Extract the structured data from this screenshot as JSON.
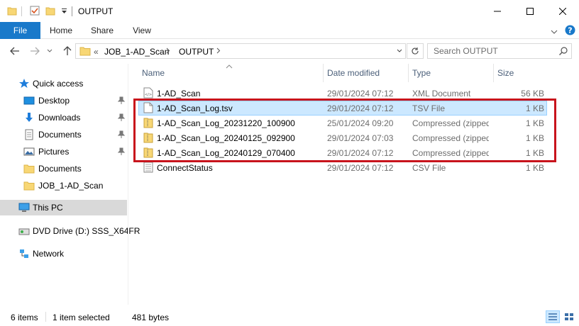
{
  "window": {
    "title": "OUTPUT",
    "minimize_glyph": "—",
    "maximize_glyph": "☐",
    "close_glyph": "✕"
  },
  "ribbon": {
    "tabs": [
      "File",
      "Home",
      "Share",
      "View"
    ]
  },
  "address": {
    "overflow": "«",
    "crumbs": [
      "JOB_1-AD_Scan",
      "OUTPUT"
    ]
  },
  "search": {
    "placeholder": "Search OUTPUT"
  },
  "sidebar": {
    "items": [
      {
        "label": "Quick access",
        "icon": "star-icon",
        "pinned": false
      },
      {
        "label": "Desktop",
        "icon": "desktop-icon",
        "pinned": true
      },
      {
        "label": "Downloads",
        "icon": "download-icon",
        "pinned": true
      },
      {
        "label": "Documents",
        "icon": "documents-icon",
        "pinned": true
      },
      {
        "label": "Pictures",
        "icon": "pictures-icon",
        "pinned": true
      },
      {
        "label": "Documents",
        "icon": "folder-icon",
        "pinned": false
      },
      {
        "label": "JOB_1-AD_Scan",
        "icon": "folder-icon",
        "pinned": false
      },
      {
        "label": "This PC",
        "icon": "computer-icon",
        "selected": true
      },
      {
        "label": "DVD Drive (D:) SSS_X64FR",
        "icon": "dvd-icon"
      },
      {
        "label": "Network",
        "icon": "network-icon"
      }
    ]
  },
  "columns": {
    "name": "Name",
    "date": "Date modified",
    "type": "Type",
    "size": "Size"
  },
  "files": [
    {
      "name": "1-AD_Scan",
      "date": "29/01/2024 07:12",
      "type": "XML Document",
      "size": "56 KB",
      "icon": "xml-file-icon"
    },
    {
      "name": "1-AD_Scan_Log.tsv",
      "date": "29/01/2024 07:12",
      "type": "TSV File",
      "size": "1 KB",
      "icon": "text-file-icon",
      "selected": true
    },
    {
      "name": "1-AD_Scan_Log_20231220_100900",
      "date": "25/01/2024 09:20",
      "type": "Compressed (zipped) Folder",
      "size": "1 KB",
      "icon": "zip-folder-icon"
    },
    {
      "name": "1-AD_Scan_Log_20240125_092900",
      "date": "29/01/2024 07:03",
      "type": "Compressed (zipped) Folder",
      "size": "1 KB",
      "icon": "zip-folder-icon"
    },
    {
      "name": "1-AD_Scan_Log_20240129_070400",
      "date": "29/01/2024 07:12",
      "type": "Compressed (zipped) Folder",
      "size": "1 KB",
      "icon": "zip-folder-icon"
    },
    {
      "name": "ConnectStatus",
      "date": "29/01/2024 07:12",
      "type": "CSV File",
      "size": "1 KB",
      "icon": "csv-file-icon"
    }
  ],
  "status": {
    "item_count": "6 items",
    "selection": "1 item selected",
    "selection_size": "481 bytes"
  },
  "colors": {
    "accent": "#1979ca",
    "selection": "#cce8ff",
    "highlight_box": "#c8141c"
  }
}
